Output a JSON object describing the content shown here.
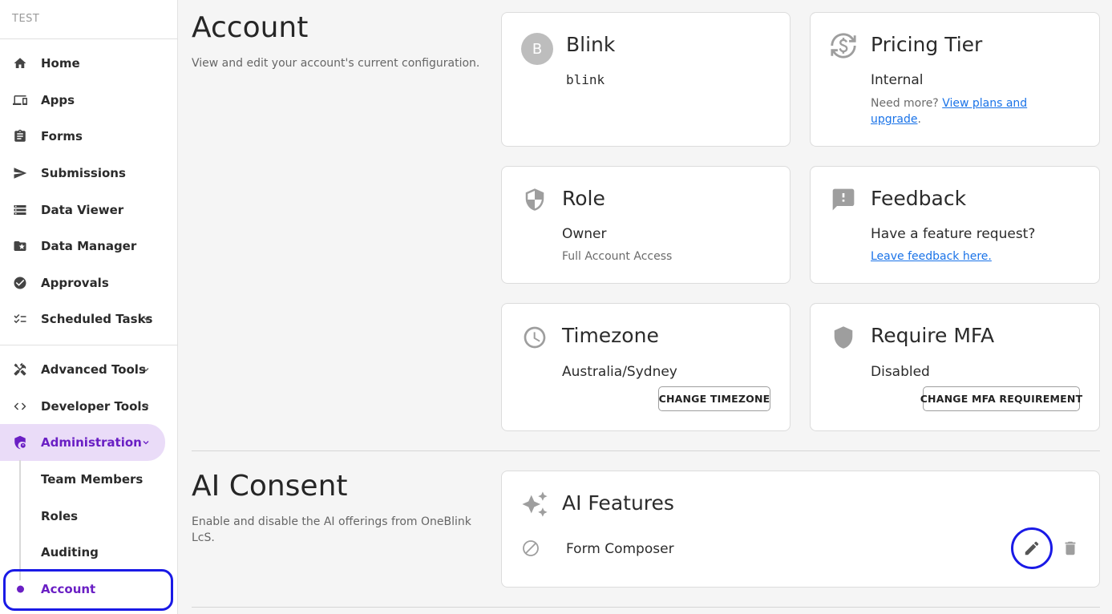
{
  "sidebar": {
    "org_name": "TEST",
    "items": [
      {
        "label": "Home",
        "icon": "home-icon"
      },
      {
        "label": "Apps",
        "icon": "devices-icon"
      },
      {
        "label": "Forms",
        "icon": "clipboard-icon"
      },
      {
        "label": "Submissions",
        "icon": "send-icon"
      },
      {
        "label": "Data Viewer",
        "icon": "storage-icon"
      },
      {
        "label": "Data Manager",
        "icon": "folder-star-icon"
      },
      {
        "label": "Approvals",
        "icon": "check-circle-icon"
      },
      {
        "label": "Scheduled Tasks",
        "icon": "checklist-icon"
      }
    ],
    "tools": [
      {
        "label": "Advanced Tools",
        "icon": "tools-icon"
      },
      {
        "label": "Developer Tools",
        "icon": "code-icon"
      },
      {
        "label": "Administration",
        "icon": "admin-shield-icon"
      }
    ],
    "admin_sub": [
      {
        "label": "Team Members"
      },
      {
        "label": "Roles"
      },
      {
        "label": "Auditing"
      },
      {
        "label": "Account"
      }
    ]
  },
  "account": {
    "title": "Account",
    "description": "View and edit your account's current configuration.",
    "blink": {
      "avatar_letter": "B",
      "title": "Blink",
      "value": "blink"
    },
    "pricing": {
      "title": "Pricing Tier",
      "value": "Internal",
      "need_more": "Need more?",
      "link_text_1": "View plans and",
      "link_text_2": "upgrade",
      "period": "."
    },
    "role": {
      "title": "Role",
      "value": "Owner",
      "sub": "Full Account Access"
    },
    "feedback": {
      "title": "Feedback",
      "value": "Have a feature request?",
      "link": "Leave feedback here."
    },
    "timezone": {
      "title": "Timezone",
      "value": "Australia/Sydney",
      "button": "CHANGE TIMEZONE"
    },
    "mfa": {
      "title": "Require MFA",
      "value": "Disabled",
      "button": "CHANGE MFA REQUIREMENT"
    }
  },
  "ai": {
    "title": "AI Consent",
    "description": "Enable and disable the AI offerings from OneBlink LcS.",
    "card_title": "AI Features",
    "feature": "Form Composer"
  },
  "colors": {
    "accent": "#6a1fc4",
    "link": "#1a73e8",
    "focus": "#1a1ae6"
  }
}
